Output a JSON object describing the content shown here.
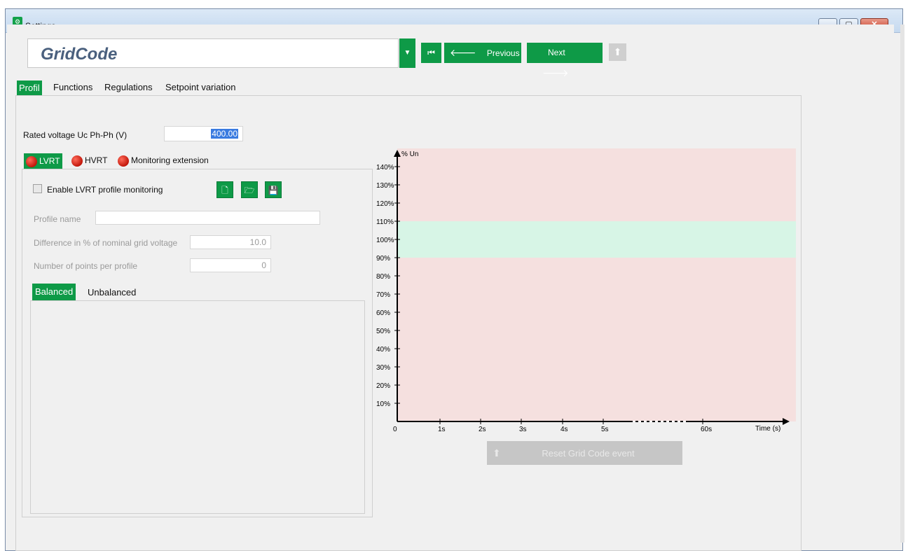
{
  "window": {
    "title": "Settings",
    "app_icon": "settings-gear-icon"
  },
  "header": {
    "gridcode_value": "GridCode",
    "previous_label": "Previous",
    "next_label": "Next"
  },
  "tabs": [
    "Profil",
    "Functions",
    "Regulations",
    "Setpoint variation"
  ],
  "profil": {
    "rated_voltage_label": "Rated voltage Uc Ph-Ph (V)",
    "rated_voltage_value": "400.00",
    "subtabs": [
      "LVRT",
      "HVRT",
      "Monitoring extension"
    ],
    "enable_label": "Enable LVRT profile monitoring",
    "profile_name_label": "Profile name",
    "profile_name_value": "",
    "difference_label": "Difference in % of nominal grid voltage",
    "difference_value": "10.0",
    "points_label": "Number of points per profile",
    "points_value": "0",
    "balance_tabs": [
      "Balanced",
      "Unbalanced"
    ],
    "reset_label": "Reset Grid Code event"
  },
  "colors": {
    "accent": "#0e9a47",
    "danger_zone": "#f5e0df",
    "safe_zone": "#d7f5e6"
  },
  "chart_data": {
    "type": "area",
    "ylabel": "% Un",
    "xlabel": "Time (s)",
    "y_ticks": [
      "10%",
      "20%",
      "30%",
      "40%",
      "50%",
      "60%",
      "70%",
      "80%",
      "90%",
      "100%",
      "110%",
      "120%",
      "130%",
      "140%"
    ],
    "x_ticks": [
      "0",
      "1s",
      "2s",
      "3s",
      "4s",
      "5s",
      "60s"
    ],
    "ylim": [
      0,
      150
    ],
    "series": [
      {
        "name": "",
        "from": 0,
        "to": 90,
        "color": "#f5e0df"
      },
      {
        "name": "",
        "from": 90,
        "to": 110,
        "color": "#d7f5e6"
      },
      {
        "name": "",
        "from": 110,
        "to": 150,
        "color": "#f5e0df"
      }
    ]
  }
}
